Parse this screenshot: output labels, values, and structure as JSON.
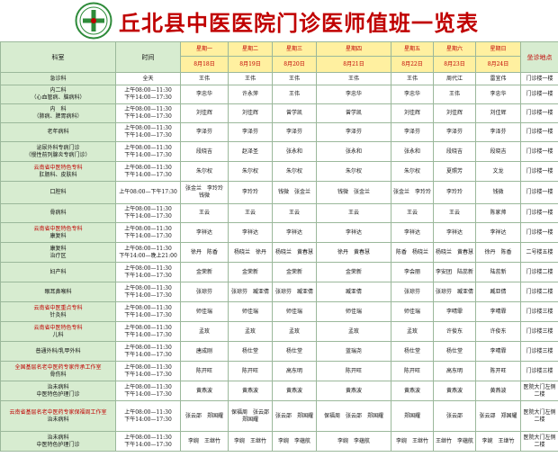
{
  "title": "丘北县中医医院门诊医师值班一览表",
  "colors": {
    "title_red": "#c00000",
    "header_yellow": "#fff0a0",
    "dept_green": "#d7ecd0",
    "border": "#9bb89b"
  },
  "header": {
    "dept": "科室",
    "time": "时间",
    "location": "坐诊地点",
    "days": [
      "星期一",
      "星期二",
      "星期三",
      "星期四",
      "星期五",
      "星期六",
      "星期日"
    ],
    "dates": [
      "8月18日",
      "8月19日",
      "8月20日",
      "8月21日",
      "8月22日",
      "8月23日",
      "8月24日"
    ]
  },
  "rows": [
    {
      "dept": [
        "急诊科"
      ],
      "time": [
        "全天"
      ],
      "docs": [
        "王伟",
        "王伟",
        "王伟",
        "王伟",
        "王伟",
        "周代江",
        "雷宜伟"
      ],
      "loc": "门诊楼一楼",
      "h": 14
    },
    {
      "dept": [
        "内二科",
        "（心血管病、脑病科）"
      ],
      "time": [
        "上午08:00—11:30",
        "下午14:00—17:30"
      ],
      "docs": [
        "李忠华",
        "许永萍",
        "王伟",
        "李忠华",
        "李忠华",
        "王伟",
        "李忠华"
      ],
      "loc": "门诊楼一楼",
      "h": 21
    },
    {
      "dept": [
        "内　科",
        "（肺病、脾胃病科）"
      ],
      "time": [
        "上午08:00—11:30",
        "下午14:00—17:30"
      ],
      "docs": [
        "刘佳辉",
        "刘佳辉",
        "曾学凯",
        "曾学凯",
        "刘佳辉",
        "刘佳辉",
        "刘佳辉"
      ],
      "loc": "门诊楼一楼",
      "h": 21
    },
    {
      "dept": [
        "老年病科"
      ],
      "time": [
        "上午08:00—11:30",
        "下午14:00—17:30"
      ],
      "docs": [
        "李泽芬",
        "李泽芬",
        "李泽芬",
        "李泽芬",
        "李泽芬",
        "李泽芬",
        "李泽芬"
      ],
      "loc": "门诊楼一楼",
      "h": 21
    },
    {
      "dept": [
        "泌尿外科专病门诊",
        "（慢性前列腺炎专病门诊）"
      ],
      "time": [
        "上午08:00—11:30",
        "下午14:00—17:30"
      ],
      "docs": [
        "段晓吉",
        "赵泽圣",
        "张永和",
        "张永和",
        "张永和",
        "段晓吉",
        "段晓吉"
      ],
      "loc": "门诊楼一楼",
      "h": 22
    },
    {
      "dept": [
        "云南省中医特色专科",
        "肛肠科、皮肤科"
      ],
      "deptRed": [
        0
      ],
      "time": [
        "上午08:00—11:30",
        "下午14:00—17:30"
      ],
      "docs": [
        "朱尔权",
        "朱尔权",
        "朱尔权",
        "朱尔权",
        "朱尔权",
        "夏照芳",
        "文龙"
      ],
      "loc": "门诊楼一楼",
      "h": 22
    },
    {
      "dept": [
        "口腔科"
      ],
      "time": [
        "上午08:00—下午17:30"
      ],
      "docs": [
        "张金兰　李玲玲　钱微",
        "李玲玲",
        "钱微　张金兰",
        "钱微　张金兰",
        "张金兰　李玲玲",
        "李玲玲",
        "钱微"
      ],
      "loc": "门诊楼一楼",
      "h": 25
    },
    {
      "dept": [
        "骨病科"
      ],
      "time": [
        "上午08:00—11:30",
        "下午14:00—17:30"
      ],
      "docs": [
        "王云",
        "王云",
        "王云",
        "王云",
        "王云",
        "王云",
        "陈家帅"
      ],
      "loc": "门诊楼一楼",
      "h": 21
    },
    {
      "dept": [
        "云南省中医特色专科",
        "康复科"
      ],
      "deptRed": [
        0
      ],
      "time": [
        "上午08:00—11:30",
        "下午14:00—17:30"
      ],
      "docs": [
        "李祥达",
        "李祥达",
        "李祥达",
        "李祥达",
        "李祥达",
        "李祥达",
        "李祥达"
      ],
      "loc": "门诊楼一楼",
      "h": 22
    },
    {
      "dept": [
        "康复科",
        "治疗区"
      ],
      "time": [
        "上午08:00—11:30",
        "下午14:00—晚上21:00"
      ],
      "docs": [
        "徐丹　陈香",
        "杨晓兰　徐丹",
        "杨晓兰　黄春慧",
        "徐丹　黄春慧",
        "陈香　杨晓兰",
        "杨晓兰　黄春慧",
        "徐丹　陈香"
      ],
      "loc": "二号楼五楼",
      "h": 22
    },
    {
      "dept": [
        "妇产科"
      ],
      "time": [
        "上午08:00—11:30",
        "下午14:00—17:30"
      ],
      "docs": [
        "金荣新",
        "金荣新",
        "金荣新",
        "金荣新",
        "李会丽",
        "李安团　陆蕊新",
        "陆蕊新"
      ],
      "loc": "门诊楼二楼",
      "h": 22
    },
    {
      "dept": [
        "眼耳鼻喉科"
      ],
      "time": [
        "上午08:00—11:30",
        "下午14:00—17:30"
      ],
      "docs": [
        "张琼芬",
        "张琼芬　臧亚倩",
        "张琼芬　臧亚倩",
        "臧亚倩",
        "张琼芬",
        "张琼芬　臧亚倩",
        "臧亚倩"
      ],
      "loc": "门诊楼二楼",
      "h": 22
    },
    {
      "dept": [
        "云南省中医重点专科",
        "针灸科"
      ],
      "deptRed": [
        0
      ],
      "time": [
        "上午08:00—11:30",
        "下午14:00—17:30"
      ],
      "docs": [
        "师佳瑞",
        "师佳瑞",
        "师佳瑞",
        "师佳瑞",
        "师佳瑞",
        "李晴霏",
        "李晴霏"
      ],
      "loc": "门诊楼三楼",
      "h": 22
    },
    {
      "dept": [
        "云南省中医特色专科",
        "儿科"
      ],
      "deptRed": [
        0
      ],
      "time": [
        "上午08:00—11:30",
        "下午14:00—17:30"
      ],
      "docs": [
        "孟玫",
        "孟玫",
        "孟玫",
        "孟玫",
        "孟玫",
        "许俊东",
        "许俊东"
      ],
      "loc": "门诊楼三楼",
      "h": 22
    },
    {
      "dept": [
        "普通外科/乳甲外科"
      ],
      "time": [
        "上午08:00—11:30",
        "下午14:00—17:30"
      ],
      "docs": [
        "唐成刚",
        "杨仕堂",
        "杨仕堂",
        "蓝瑞尧",
        "杨仕堂",
        "杨仕堂",
        "李晴霏"
      ],
      "loc": "门诊楼三楼",
      "h": 22
    },
    {
      "dept": [
        "全国基层名老中医药专家传承工作室",
        "骨伤科"
      ],
      "deptRed": [
        0
      ],
      "time": [
        "上午08:00—11:30",
        "下午14:00—17:30"
      ],
      "docs": [
        "陈开旺",
        "陈开旺",
        "高东明",
        "陈开旺",
        "陈开旺",
        "高东明",
        "陈开旺"
      ],
      "loc": "门诊楼三楼",
      "h": 22
    },
    {
      "dept": [
        "治未病科",
        "中医特色护理门诊"
      ],
      "time": [
        "上午08:00—11:30",
        "下午14:00—17:30"
      ],
      "docs": [
        "黄燕波",
        "黄燕波",
        "黄燕波",
        "黄燕波",
        "黄燕波",
        "黄燕波",
        "黄燕波"
      ],
      "loc": "医院大门左侧二楼",
      "h": 22
    },
    {
      "dept": [
        "云南省基层名老中医药专家保福周工作室",
        "治未病科"
      ],
      "deptRed": [
        0
      ],
      "time": [
        "上午08:00—11:30",
        "下午14:00—17:30"
      ],
      "docs": [
        "张云邵　郑国耀",
        "保福周　张云邵　郑国耀",
        "张云邵　郑国耀",
        "保福周　张云邵　郑国耀",
        "郑国耀",
        "张云邵",
        "张云邵　郑国耀"
      ],
      "loc": "医院大门左侧二楼",
      "h": 34
    },
    {
      "dept": [
        "治未病科",
        "中医特色护理门诊"
      ],
      "time": [
        "上午08:00—11:30",
        "下午14:00—17:30"
      ],
      "docs": [
        "李婉　王继竹",
        "李婉　王继竹",
        "李婉　李蕴航",
        "李婉　李蕴航",
        "李婉　王继竹",
        "王继竹　李蕴航",
        "李婉　王继竹"
      ],
      "loc": "医院大门左侧二楼",
      "h": 22
    }
  ]
}
